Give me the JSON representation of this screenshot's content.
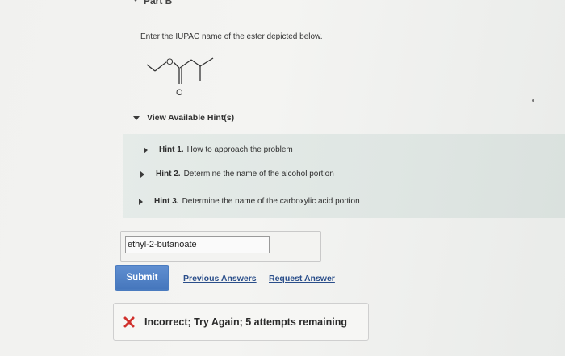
{
  "part": {
    "title": "Part B"
  },
  "question": {
    "text": "Enter the IUPAC name of the ester depicted below."
  },
  "molecule": {
    "oxygen_label": "O"
  },
  "hints": {
    "toggle_label": "View Available Hint(s)",
    "items": [
      {
        "number": "Hint 1.",
        "text": "How to approach the problem"
      },
      {
        "number": "Hint 2.",
        "text": "Determine the name of the alcohol portion"
      },
      {
        "number": "Hint 3.",
        "text": "Determine the name of the carboxylic acid portion"
      }
    ]
  },
  "answer": {
    "value": "ethyl-2-butanoate"
  },
  "actions": {
    "submit_label": "Submit",
    "previous_answers_label": "Previous Answers",
    "request_answer_label": "Request Answer"
  },
  "feedback": {
    "text": "Incorrect; Try Again; 5 attempts remaining",
    "icon": "x-icon",
    "icon_color": "#d0312d"
  },
  "colors": {
    "accent": "#4a7bbf",
    "link": "#2a4e8a",
    "hint_panel": "#e1e7e4"
  }
}
